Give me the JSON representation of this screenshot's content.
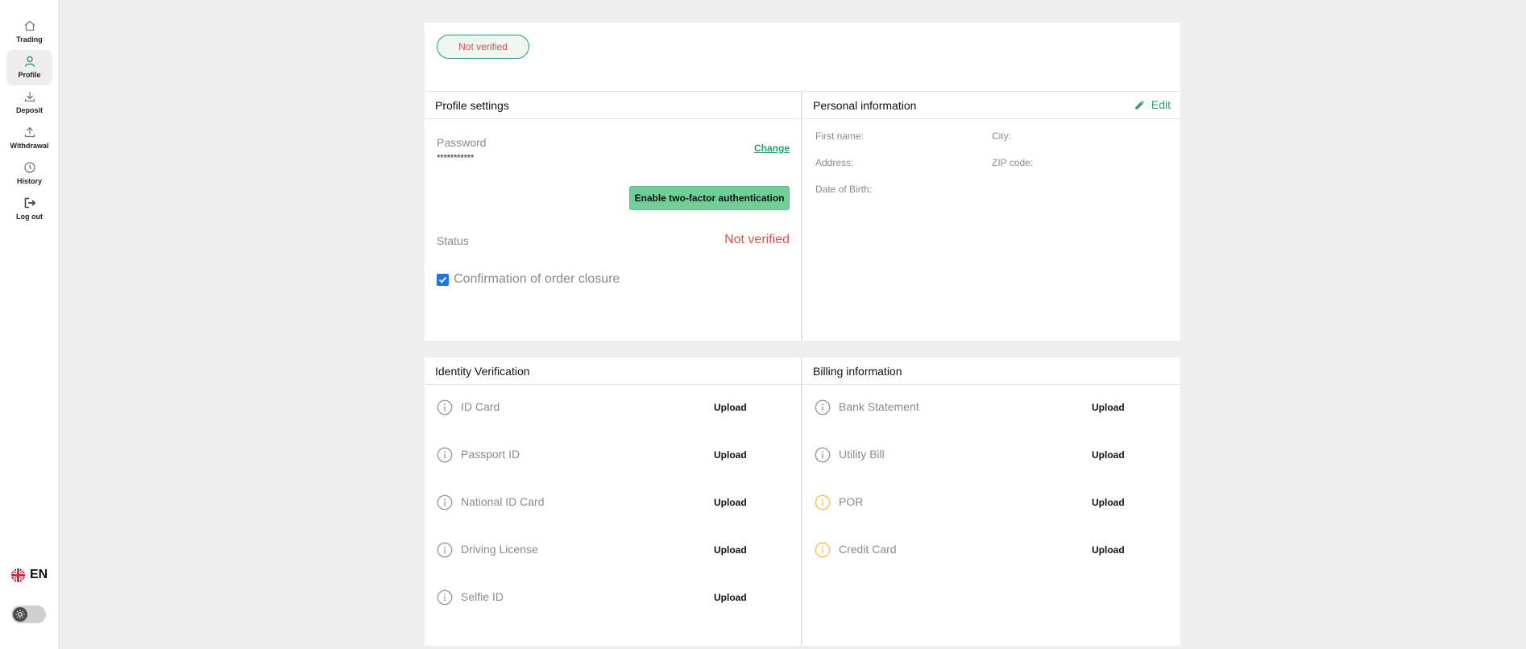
{
  "sidebar": {
    "items": [
      {
        "label": "Trading",
        "icon": "home-icon"
      },
      {
        "label": "Profile",
        "icon": "user-icon",
        "active": true
      },
      {
        "label": "Deposit",
        "icon": "download-icon"
      },
      {
        "label": "Withdrawal",
        "icon": "upload-icon"
      },
      {
        "label": "History",
        "icon": "clock-icon"
      },
      {
        "label": "Log out",
        "icon": "logout-icon"
      }
    ],
    "language": "EN",
    "language_icon": "uk-flag-icon",
    "theme_toggle_icon": "sun-icon"
  },
  "top": {
    "badge": "Not verified"
  },
  "profile_settings": {
    "title": "Profile settings",
    "password_label": "Password",
    "password_value": "***********",
    "change_label": "Change",
    "tfa_button": "Enable two-factor authentication",
    "status_label": "Status",
    "status_value": "Not verified",
    "confirm_label": "Confirmation of order closure",
    "confirm_checked": true
  },
  "personal_info": {
    "title": "Personal information",
    "edit_label": "Edit",
    "fields": {
      "first_name": "First name:",
      "city": "City:",
      "address": "Address:",
      "zip": "ZIP code:",
      "dob": "Date of Birth:"
    }
  },
  "identity": {
    "title": "Identity Verification",
    "items": [
      {
        "label": "ID Card",
        "action": "Upload",
        "icon_color": "#9a9a9a"
      },
      {
        "label": "Passport ID",
        "action": "Upload",
        "icon_color": "#9a9a9a"
      },
      {
        "label": "National ID Card",
        "action": "Upload",
        "icon_color": "#9a9a9a"
      },
      {
        "label": "Driving License",
        "action": "Upload",
        "icon_color": "#9a9a9a"
      },
      {
        "label": "Selfie ID",
        "action": "Upload",
        "icon_color": "#9a9a9a"
      }
    ]
  },
  "billing": {
    "title": "Billing information",
    "items": [
      {
        "label": "Bank Statement",
        "action": "Upload",
        "icon_color": "#9a9a9a"
      },
      {
        "label": "Utility Bill",
        "action": "Upload",
        "icon_color": "#9a9a9a"
      },
      {
        "label": "POR",
        "action": "Upload",
        "icon_color": "#f2c14e"
      },
      {
        "label": "Credit Card",
        "action": "Upload",
        "icon_color": "#f2c14e"
      }
    ]
  },
  "colors": {
    "accent": "#2e9c6e",
    "danger": "#e05050",
    "button": "#6fcf97",
    "warning": "#f2c14e"
  }
}
